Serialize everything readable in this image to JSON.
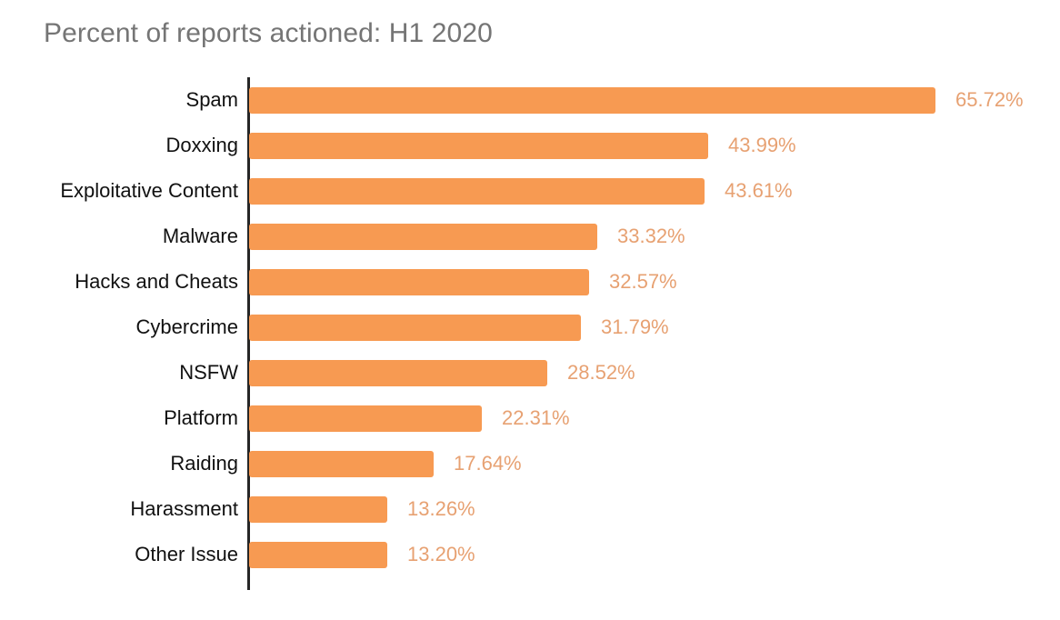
{
  "chart_data": {
    "type": "bar",
    "orientation": "horizontal",
    "title": "Percent of reports actioned: H1 2020",
    "xlabel": "",
    "ylabel": "",
    "xlim": [
      0,
      65.72
    ],
    "grid": false,
    "legend": null,
    "value_suffix": "%",
    "bar_color": "#F79A52",
    "value_label_color": "#E7A172",
    "title_color": "#757575",
    "category_label_color": "#111111",
    "axis_color": "#262626",
    "background": "#ffffff",
    "categories": [
      "Spam",
      "Doxxing",
      "Exploitative Content",
      "Malware",
      "Hacks and Cheats",
      "Cybercrime",
      "NSFW",
      "Platform",
      "Raiding",
      "Harassment",
      "Other Issue"
    ],
    "values": [
      65.72,
      43.99,
      43.61,
      33.32,
      32.57,
      31.79,
      28.52,
      22.31,
      17.64,
      13.26,
      13.2
    ],
    "value_labels": [
      "65.72%",
      "43.99%",
      "43.61%",
      "33.32%",
      "32.57%",
      "31.79%",
      "28.52%",
      "22.31%",
      "17.64%",
      "13.26%",
      "13.20%"
    ]
  }
}
